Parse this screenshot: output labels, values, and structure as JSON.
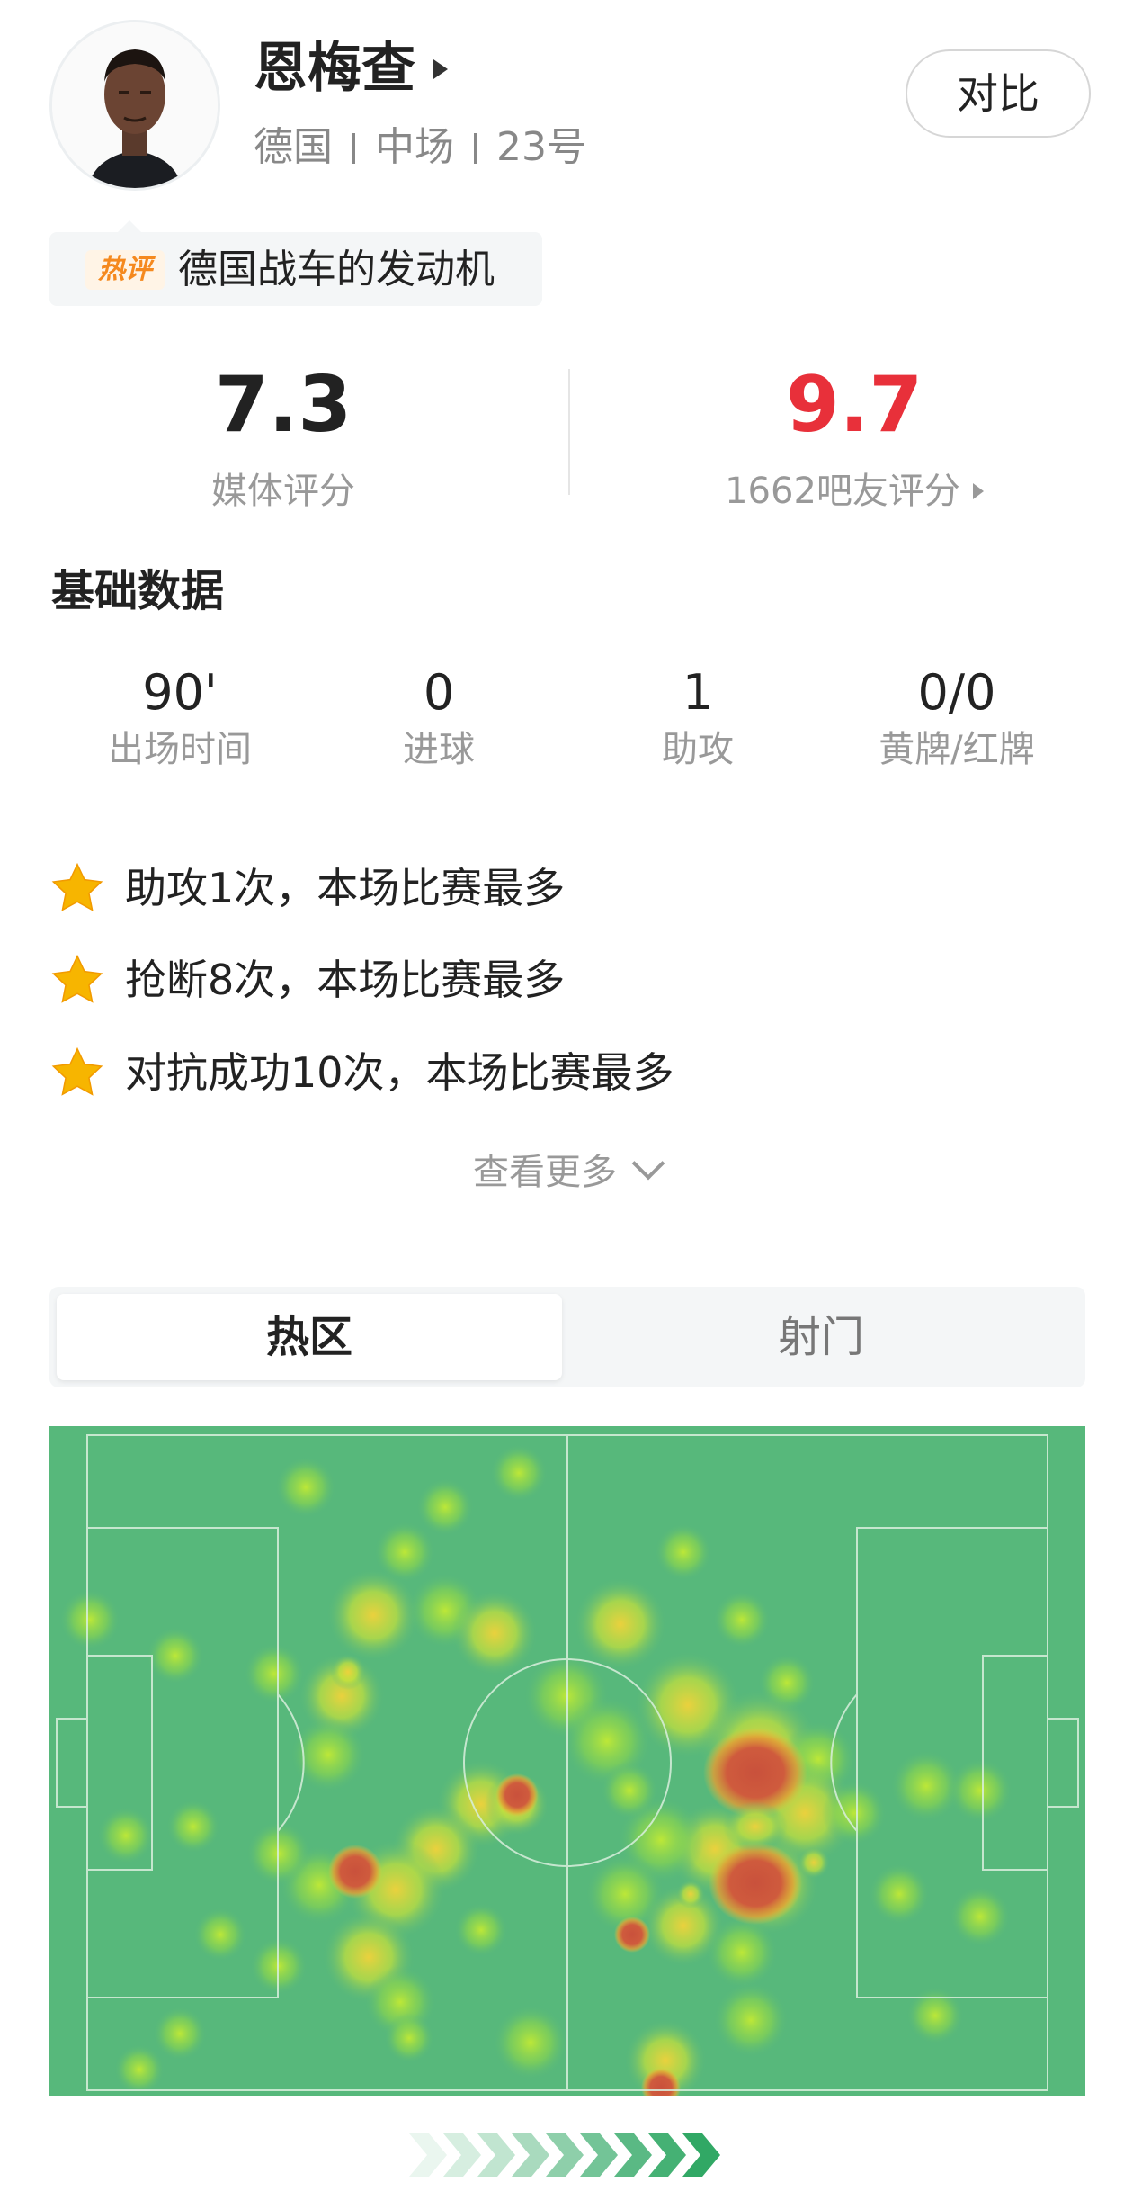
{
  "player": {
    "name": "恩梅查",
    "country": "德国",
    "position": "中场",
    "number": "23号",
    "avatar_icon": "player-photo"
  },
  "compare_button": "对比",
  "hot_comment": {
    "badge": "热评",
    "text": "德国战车的发动机"
  },
  "ratings": {
    "media_score": "7.3",
    "media_label": "媒体评分",
    "fan_score": "9.7",
    "fan_label": "1662吧友评分",
    "fan_score_color": "#e8303a"
  },
  "basic_stats": {
    "title": "基础数据",
    "items": [
      {
        "value": "90'",
        "label": "出场时间"
      },
      {
        "value": "0",
        "label": "进球"
      },
      {
        "value": "1",
        "label": "助攻"
      },
      {
        "value": "0/0",
        "label": "黄牌/红牌"
      }
    ]
  },
  "highlights": [
    {
      "icon": "star-icon",
      "text": "助攻1次，本场比赛最多"
    },
    {
      "icon": "star-icon",
      "text": "抢断8次，本场比赛最多"
    },
    {
      "icon": "star-icon",
      "text": "对抗成功10次，本场比赛最多"
    }
  ],
  "see_more": "查看更多",
  "tabs": [
    {
      "label": "热区",
      "active": true
    },
    {
      "label": "射门",
      "active": false
    }
  ],
  "heatmap": {
    "pitch_color": "#57b87b",
    "attack_direction_icon": "chevron-arrows-right"
  }
}
